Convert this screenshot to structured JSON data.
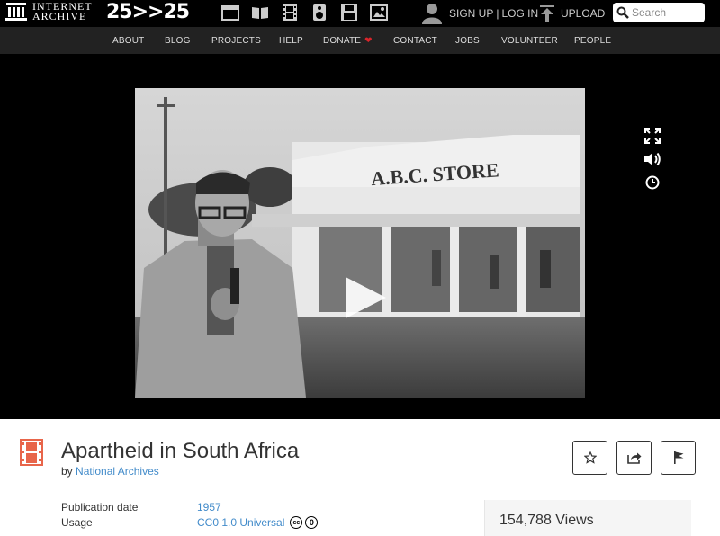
{
  "topbar": {
    "logo_line1": "INTERNET",
    "logo_line2": "ARCHIVE",
    "anniversary": "25>>25",
    "media_icons": [
      "web-icon",
      "texts-icon",
      "video-icon",
      "audio-icon",
      "software-icon",
      "images-icon"
    ],
    "signup_label": "SIGN UP",
    "separator": "|",
    "login_label": "LOG IN",
    "upload_label": "UPLOAD",
    "search_placeholder": "Search"
  },
  "nav": {
    "items": [
      "ABOUT",
      "BLOG",
      "PROJECTS",
      "HELP",
      "DONATE",
      "CONTACT",
      "JOBS",
      "VOLUNTEER",
      "PEOPLE"
    ]
  },
  "player": {
    "controls": [
      "fullscreen-icon",
      "volume-icon",
      "clock-icon"
    ],
    "sign_text": "A.B.C. STORE"
  },
  "item": {
    "title": "Apartheid in South Africa",
    "by_prefix": "by",
    "creator": "National Archives",
    "meta": [
      {
        "key": "Publication date",
        "value": "1957"
      },
      {
        "key": "Usage",
        "value": "CC0 1.0 Universal"
      }
    ],
    "views": "154,788 Views"
  },
  "colors": {
    "link": "#428bca",
    "accent": "#e8654a",
    "heart": "#d9252b"
  }
}
